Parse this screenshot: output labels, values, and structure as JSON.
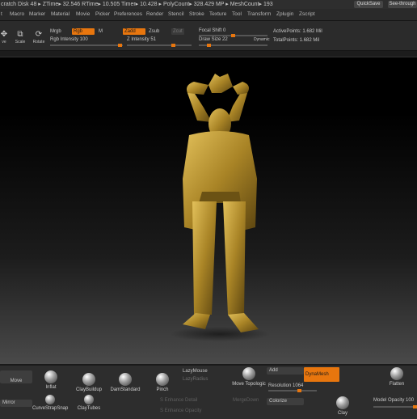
{
  "title_bar": {
    "text": "cratch Disk 48 ▸ ZTime▸ 32.546 RTime▸ 10.505 Timer▸ 10.428 ▸ PolyCount▸ 328.429 MP ▸ MeshCount▸ 193",
    "quicksave": "QuickSave",
    "see_through": "See-through"
  },
  "menu": [
    "t",
    "Macro",
    "Marker",
    "Material",
    "Movie",
    "Picker",
    "Preferences",
    "Render",
    "Stencil",
    "Stroke",
    "Texture",
    "Tool",
    "Transform",
    "Zplugin",
    "Zscript"
  ],
  "toolbar": {
    "tools": [
      {
        "label": "ve",
        "icon": "move-icon"
      },
      {
        "label": "Scale",
        "icon": "scale-icon"
      },
      {
        "label": "Rotate",
        "icon": "rotate-icon"
      }
    ],
    "mrgb": "Mrgb",
    "rgb": "Rgb",
    "m": "M",
    "rgb_intensity": "Rgb Intensity 100",
    "zadd": "Zadd",
    "zsub": "Zsub",
    "zcut": "Zcut",
    "z_intensity": "Z Intensity 51",
    "focal_shift": "Focal Shift 0",
    "draw_size": "Draw Size 22",
    "dynamic": "Dynamic",
    "active_points": "ActivePoints: 1.682 Mil",
    "total_points": "TotalPoints: 1.682 Mil"
  },
  "shelf": {
    "move": "Move",
    "inflat": "Inflat",
    "claybuildup": "ClayBuildup",
    "damstandard": "DamStandard",
    "pinch": "Pinch",
    "lazymouse": "LazyMouse",
    "lazyradius": "LazyRadius",
    "move_topologic": "Move Topologic",
    "add": "Add",
    "dynamesh": "DynaMesh",
    "resolution": "Resolution 1064",
    "flatten": "Flatten",
    "mirror": "Mirror",
    "curvestrapsnap": "CurveStrapSnap",
    "claytubes": "ClayTubes",
    "s_enhance_detail": "S Enhance Detail",
    "s_enhance_opacity": "S Enhance Opacity",
    "merge_down": "MergeDown",
    "colorize": "Colorize",
    "clay": "Clay",
    "model_opacity": "Model Opacity 100"
  },
  "colors": {
    "accent": "#e8760e",
    "figure": "#b08a2c"
  }
}
